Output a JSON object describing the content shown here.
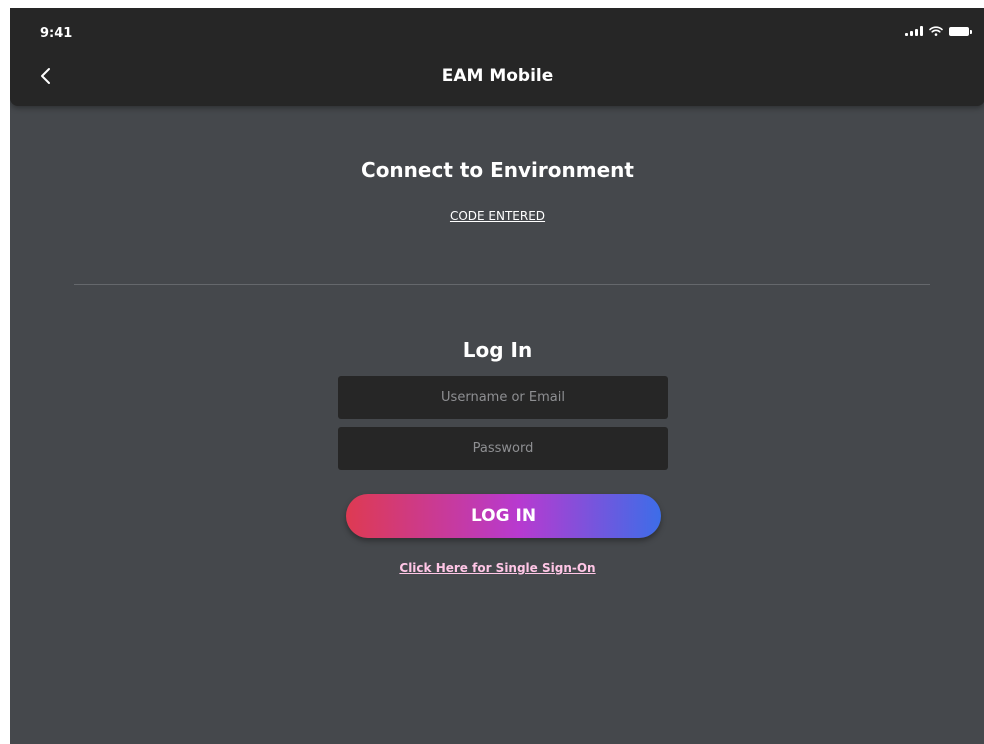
{
  "status_bar": {
    "time": "9:41",
    "icons": [
      "signal-icon",
      "wifi-icon",
      "battery-icon"
    ]
  },
  "nav": {
    "title": "EAM Mobile",
    "back_icon": "chevron-left-icon"
  },
  "environment": {
    "title": "Connect to Environment",
    "code_link": "CODE ENTERED"
  },
  "login": {
    "title": "Log In",
    "username_placeholder": "Username or Email",
    "username_value": "",
    "password_placeholder": "Password",
    "password_value": "",
    "button_label": "LOG IN",
    "sso_link": "Click Here for Single Sign-On"
  },
  "colors": {
    "background": "#45484c",
    "topbar": "#262626",
    "input_bg": "#262626",
    "gradient_start": "#de3a52",
    "gradient_mid": "#b73ad0",
    "gradient_end": "#3d6de8",
    "sso_link": "#ffc6e6"
  }
}
